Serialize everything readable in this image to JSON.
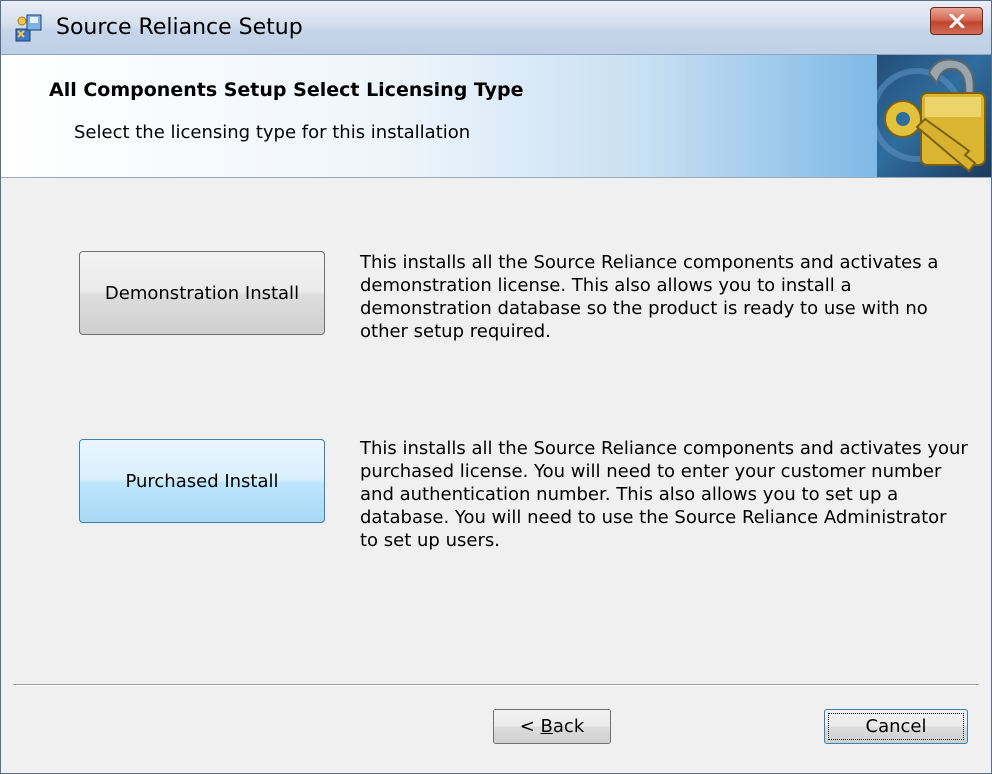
{
  "window": {
    "title": "Source Reliance Setup",
    "app_icon": "installer-icon",
    "close_icon": "close-icon"
  },
  "banner": {
    "title": "All Components Setup Select Licensing Type",
    "subtitle": "Select the licensing type for this installation",
    "image": "padlock-key-icon"
  },
  "options": {
    "demo": {
      "button_label": "Demonstration Install",
      "description": "This installs all the Source Reliance components and activates a demonstration license. This also allows you to install a demonstration database so the product is ready to use with no other setup required."
    },
    "purchased": {
      "button_label": "Purchased Install",
      "description": "This installs all the Source Reliance components and activates your purchased license. You will need to enter your customer number and authentication number. This also allows you to set up a database. You will need to use the Source Reliance Administrator to set up users."
    }
  },
  "footer": {
    "back_prefix": "< ",
    "back_accel": "B",
    "back_rest": "ack",
    "cancel_label": "Cancel"
  },
  "colors": {
    "close_button": "#c0442c",
    "purchased_button": "#bee6fd",
    "banner_accent": "#5aa6e0"
  }
}
